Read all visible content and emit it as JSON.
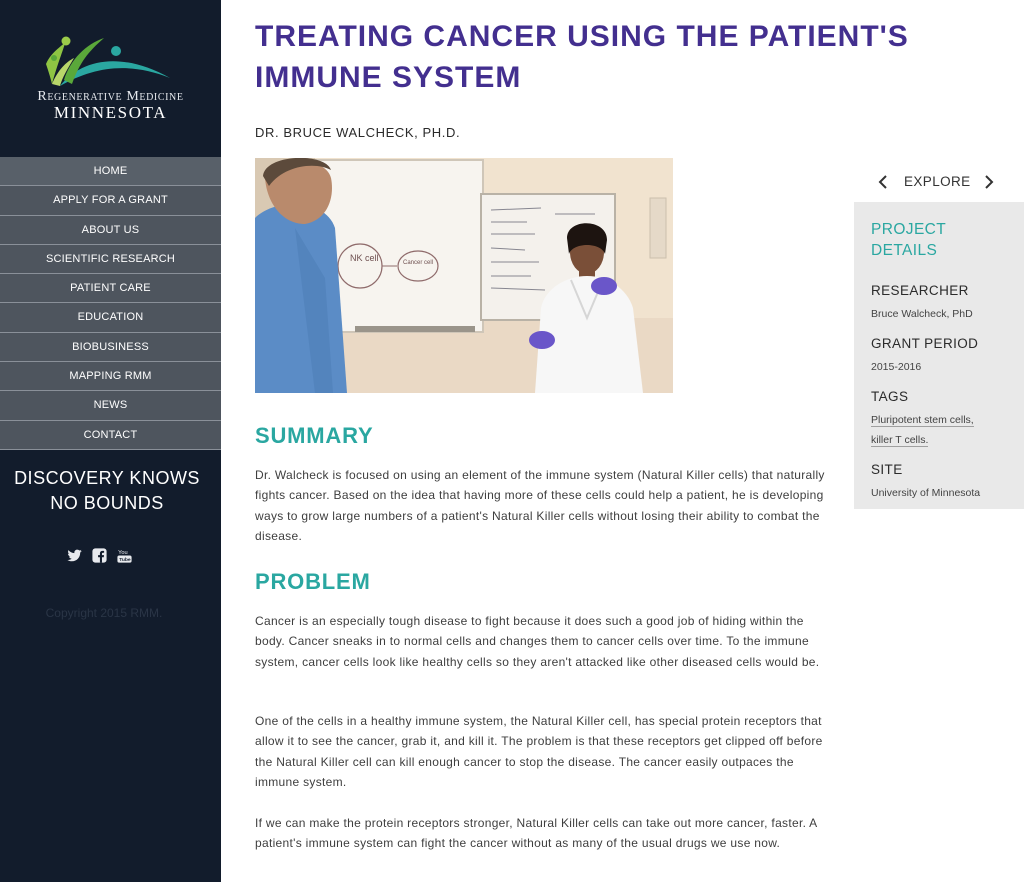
{
  "sidebar": {
    "logo": {
      "line1": "Regenerative Medicine",
      "line2": "MINNESOTA"
    },
    "nav": [
      {
        "label": "HOME"
      },
      {
        "label": "APPLY FOR A GRANT"
      },
      {
        "label": "ABOUT US"
      },
      {
        "label": "SCIENTIFIC RESEARCH"
      },
      {
        "label": "PATIENT CARE"
      },
      {
        "label": "EDUCATION"
      },
      {
        "label": "BIOBUSINESS"
      },
      {
        "label": "MAPPING RMM"
      },
      {
        "label": "NEWS"
      },
      {
        "label": "CONTACT"
      }
    ],
    "tagline_line1": "DISCOVERY KNOWS",
    "tagline_line2": "NO BOUNDS",
    "social": [
      "twitter-icon",
      "facebook-icon",
      "youtube-icon"
    ],
    "copyright": "Copyright 2015 RMM."
  },
  "main": {
    "title_line1": "TREATING CANCER USING THE PATIENT'S",
    "title_line2": "IMMUNE SYSTEM",
    "author": "DR. BRUCE WALCHECK, PH.D.",
    "photo_whiteboard_text1": "NK cell",
    "photo_whiteboard_text2": "Cancer cell",
    "summary_heading": "SUMMARY",
    "summary_text": "Dr. Walcheck is focused on using an element of the immune system (Natural Killer cells) that naturally fights cancer. Based on the idea that having more of these cells could help a patient, he is developing ways to grow large numbers of a patient's Natural Killer cells without losing their ability to combat the disease.",
    "problem_heading": "PROBLEM",
    "problem_p1": "Cancer is an especially tough disease to fight because it does such a good job of hiding within the body. Cancer sneaks in to normal cells and changes them to cancer cells over time. To the immune system, cancer cells look like healthy cells so they aren't attacked like other diseased cells would be.",
    "problem_p2": "One of the cells in a healthy immune system, the Natural Killer cell, has special protein receptors that allow it to see the cancer, grab it, and kill it. The problem is that these receptors get clipped off before the Natural Killer cell can kill enough cancer to stop the disease.  The cancer easily outpaces the immune system.",
    "problem_p3": "If we can make the protein receptors stronger, Natural Killer cells can take out more cancer, faster. A patient's immune system can fight the cancer without as many of the usual drugs we use now."
  },
  "explore": {
    "label": "EXPLORE"
  },
  "details": {
    "title_line1": "PROJECT",
    "title_line2": "DETAILS",
    "researcher_label": "RESEARCHER",
    "researcher_value": "Bruce Walcheck, PhD",
    "grant_label": "GRANT PERIOD",
    "grant_value": "2015-2016",
    "tags_label": "TAGS",
    "tags": [
      "Pluripotent stem cells,",
      "killer T cells."
    ],
    "site_label": "SITE",
    "site_value": "University of Minnesota"
  },
  "colors": {
    "sidebar_bg": "#121c2c",
    "nav_bg": "#4e555e",
    "title": "#432f8f",
    "teal": "#2aa7a1",
    "details_bg": "#e9e9e9"
  }
}
